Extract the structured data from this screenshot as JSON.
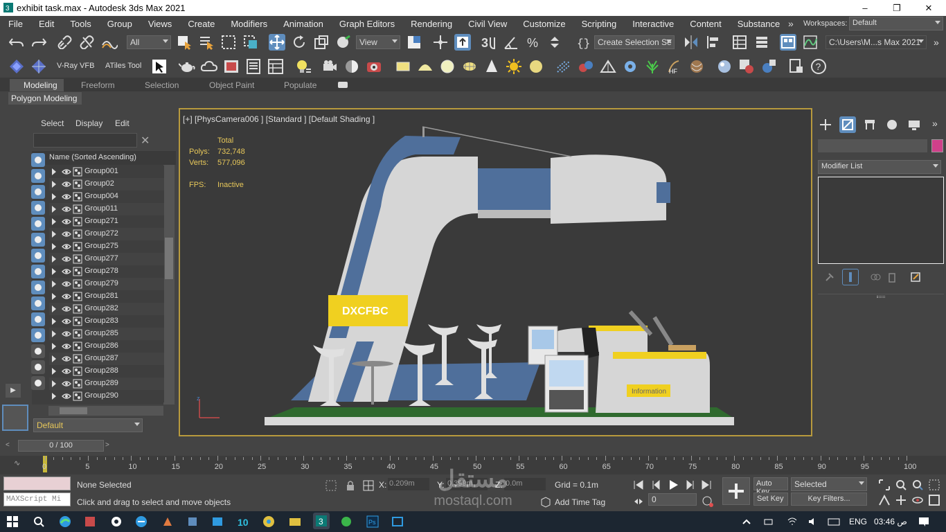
{
  "window": {
    "title": "exhibit task.max - Autodesk 3ds Max 2021",
    "minimize": "–",
    "restore": "❐",
    "close": "✕"
  },
  "menu": [
    "File",
    "Edit",
    "Tools",
    "Group",
    "Views",
    "Create",
    "Modifiers",
    "Animation",
    "Graph Editors",
    "Rendering",
    "Civil View",
    "Customize",
    "Scripting",
    "Interactive",
    "Content",
    "Substance"
  ],
  "menu_more": "»",
  "workspaces": {
    "label": "Workspaces:",
    "value": "Default"
  },
  "toolbar1": {
    "filter": "All",
    "refcoord": "View",
    "named_selection": "Create Selection Se",
    "project_path": "C:\\Users\\M...s Max 2021"
  },
  "toolbar2": {
    "vray_vfb": "V-Ray VFB",
    "atiles": "ATiles Tool"
  },
  "ribbon": {
    "tabs": [
      "Modeling",
      "Freeform",
      "Selection",
      "Object Paint",
      "Populate"
    ],
    "subtab": "Polygon Modeling"
  },
  "scene_explorer": {
    "menu": [
      "Select",
      "Display",
      "Edit"
    ],
    "column": "Name (Sorted Ascending)",
    "rows": [
      "Group001",
      "Group02",
      "Group004",
      "Group011",
      "Group271",
      "Group272",
      "Group275",
      "Group277",
      "Group278",
      "Group279",
      "Group281",
      "Group282",
      "Group283",
      "Group285",
      "Group286",
      "Group287",
      "Group288",
      "Group289",
      "Group290"
    ],
    "layer": "Default"
  },
  "viewport": {
    "label": "[+] [PhysCamera006 ] [Standard ] [Default Shading ]",
    "stats": {
      "total_label": "Total",
      "polys_label": "Polys:",
      "polys": "732,748",
      "verts_label": "Verts:",
      "verts": "577,096",
      "fps_label": "FPS:",
      "fps": "Inactive"
    },
    "sign_text": "Information",
    "logo_text": "DXCFBC"
  },
  "command_panel": {
    "modifier_list": "Modifier List"
  },
  "time": {
    "frame_display": "0 / 100",
    "ticks": [
      "0",
      "5",
      "10",
      "15",
      "20",
      "25",
      "30",
      "35",
      "40",
      "45",
      "50",
      "55",
      "60",
      "65",
      "70",
      "75",
      "80",
      "85",
      "90",
      "95",
      "100"
    ]
  },
  "status": {
    "selection": "None Selected",
    "prompt": "Click and drag to select and move objects",
    "maxscript": "MAXScript Mi",
    "x_label": "X:",
    "x": "0.209m",
    "y_label": "Y:",
    "y": "0.399m",
    "z_label": "Z:",
    "z": "0.0m",
    "grid": "Grid = 0.1m",
    "add_time_tag": "Add Time Tag",
    "auto_key": "Auto Key",
    "set_key": "Set Key",
    "key_mode": "Selected",
    "key_filters": "Key Filters...",
    "frame": "0"
  },
  "taskbar": {
    "lang": "ENG",
    "time": "03:46 ص"
  },
  "watermark": {
    "arabic": "مستقل",
    "latin": "mostaql.com"
  },
  "colors": {
    "accent": "#b89a3d",
    "selected_blue": "#5f8dbd",
    "stand_blue": "#4f6f9b",
    "yellow": "#f0d020",
    "panel": "#444444"
  }
}
